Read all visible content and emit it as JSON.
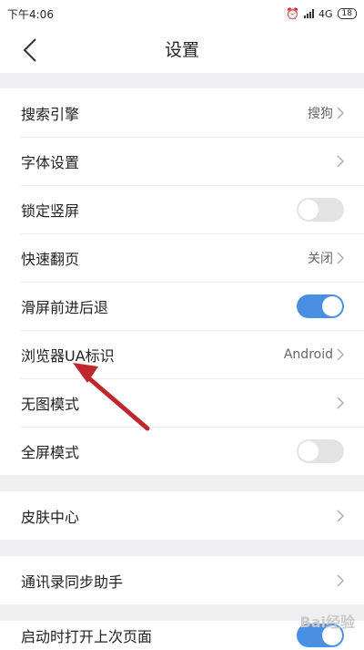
{
  "status_bar": {
    "time": "下午4:06",
    "network": "4G",
    "battery": "18"
  },
  "header": {
    "title": "设置"
  },
  "groups": [
    {
      "items": [
        {
          "label": "搜索引擎",
          "value": "搜狗",
          "type": "nav"
        },
        {
          "label": "字体设置",
          "type": "nav"
        },
        {
          "label": "锁定竖屏",
          "type": "toggle",
          "toggle_on": false
        },
        {
          "label": "快速翻页",
          "value": "关闭",
          "type": "nav"
        },
        {
          "label": "滑屏前进后退",
          "type": "toggle",
          "toggle_on": true
        },
        {
          "label": "浏览器UA标识",
          "value": "Android",
          "type": "nav"
        },
        {
          "label": "无图模式",
          "type": "nav"
        },
        {
          "label": "全屏模式",
          "type": "toggle",
          "toggle_on": false
        }
      ]
    },
    {
      "items": [
        {
          "label": "皮肤中心",
          "type": "nav"
        }
      ]
    },
    {
      "items": [
        {
          "label": "通讯录同步助手",
          "type": "nav"
        }
      ]
    },
    {
      "items": [
        {
          "label": "启动时打开上次页面",
          "type": "toggle",
          "toggle_on": true
        }
      ]
    }
  ],
  "colors": {
    "accent": "#4a90e2",
    "annotation_arrow": "#c0272d"
  },
  "watermark": "Bai经验"
}
